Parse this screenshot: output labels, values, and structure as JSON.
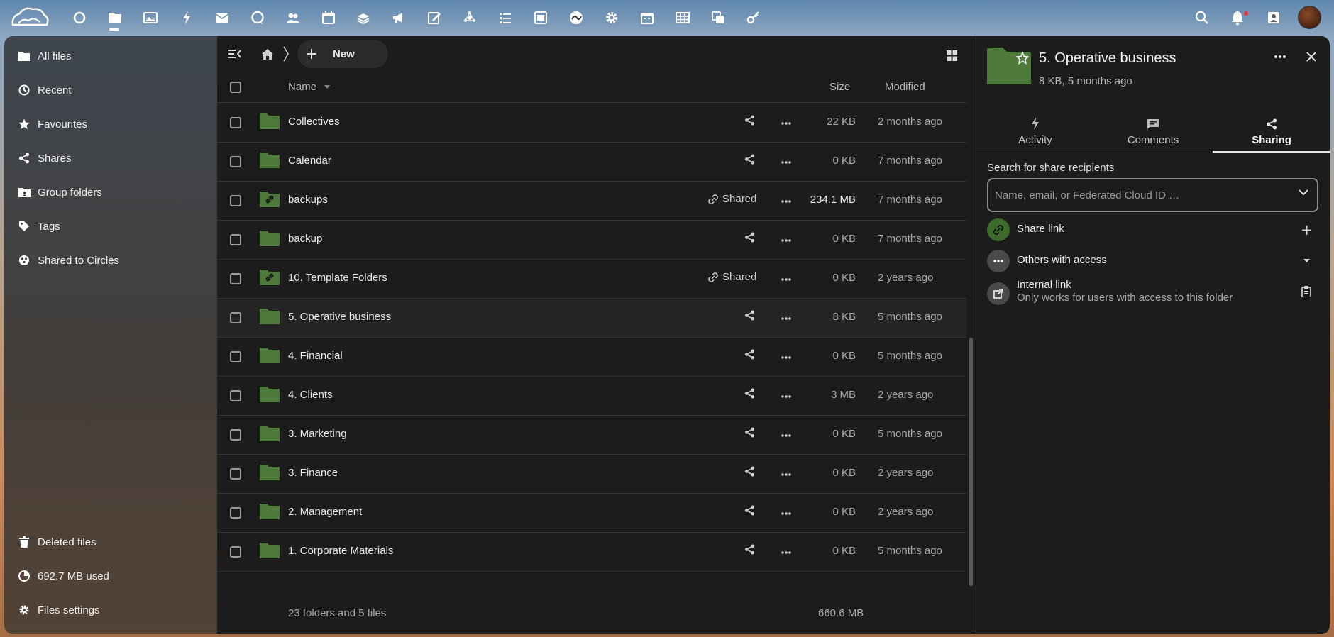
{
  "header": {
    "apps": [
      {
        "icon": "dashboard-icon"
      },
      {
        "icon": "files-icon"
      },
      {
        "icon": "photos-icon"
      },
      {
        "icon": "activity-icon"
      },
      {
        "icon": "mail-icon"
      },
      {
        "icon": "talk-icon"
      },
      {
        "icon": "contacts-icon"
      },
      {
        "icon": "calendar-icon"
      },
      {
        "icon": "deck-icon"
      },
      {
        "icon": "announcements-icon"
      },
      {
        "icon": "notes-icon"
      },
      {
        "icon": "circles-icon"
      },
      {
        "icon": "tasks-icon"
      },
      {
        "icon": "forms-icon"
      },
      {
        "icon": "whiteboard-icon"
      },
      {
        "icon": "settings-icon"
      },
      {
        "icon": "calendar-alt-icon"
      },
      {
        "icon": "tables-icon"
      },
      {
        "icon": "collectives-icon"
      },
      {
        "icon": "passwords-icon"
      }
    ],
    "right_icons": [
      "search-icon",
      "notifications-icon",
      "contacts-menu-icon"
    ]
  },
  "nav": {
    "items": [
      {
        "label": "All files",
        "icon": "folder-icon"
      },
      {
        "label": "Recent",
        "icon": "clock-icon"
      },
      {
        "label": "Favourites",
        "icon": "star-icon"
      },
      {
        "label": "Shares",
        "icon": "share-icon"
      },
      {
        "label": "Group folders",
        "icon": "group-folder-icon"
      },
      {
        "label": "Tags",
        "icon": "tag-icon"
      },
      {
        "label": "Shared to Circles",
        "icon": "circles-icon"
      }
    ],
    "bottom": [
      {
        "label": "Deleted files",
        "icon": "trash-icon"
      },
      {
        "label": "692.7 MB used",
        "icon": "quota-pie-icon"
      },
      {
        "label": "Files settings",
        "icon": "gear-icon"
      }
    ]
  },
  "files": {
    "new_label": "New",
    "columns": {
      "name": "Name",
      "size": "Size",
      "modified": "Modified"
    },
    "rows": [
      {
        "name": "Collectives",
        "size": "22 KB",
        "modified": "2 months ago",
        "shared": false
      },
      {
        "name": "Calendar",
        "size": "0 KB",
        "modified": "7 months ago",
        "shared": false
      },
      {
        "name": "backups",
        "size": "234.1 MB",
        "modified": "7 months ago",
        "shared": true,
        "share_label": "Shared"
      },
      {
        "name": "backup",
        "size": "0 KB",
        "modified": "7 months ago",
        "shared": false
      },
      {
        "name": "10. Template Folders",
        "size": "0 KB",
        "modified": "2 years ago",
        "shared": true,
        "share_label": "Shared"
      },
      {
        "name": "5. Operative business",
        "size": "8 KB",
        "modified": "5 months ago",
        "shared": false,
        "selected": true
      },
      {
        "name": "4. Financial",
        "size": "0 KB",
        "modified": "5 months ago",
        "shared": false
      },
      {
        "name": "4. Clients",
        "size": "3 MB",
        "modified": "2 years ago",
        "shared": false
      },
      {
        "name": "3. Marketing",
        "size": "0 KB",
        "modified": "5 months ago",
        "shared": false
      },
      {
        "name": "3. Finance",
        "size": "0 KB",
        "modified": "2 years ago",
        "shared": false
      },
      {
        "name": "2. Management",
        "size": "0 KB",
        "modified": "2 years ago",
        "shared": false
      },
      {
        "name": "1. Corporate Materials",
        "size": "0 KB",
        "modified": "5 months ago",
        "shared": false
      }
    ],
    "summary": "23 folders and 5 files",
    "total_size": "660.6 MB"
  },
  "sidebar": {
    "title": "5. Operative business",
    "subtitle": "8 KB, 5 months ago",
    "tabs": [
      {
        "label": "Activity",
        "icon": "activity-icon"
      },
      {
        "label": "Comments",
        "icon": "comment-icon"
      },
      {
        "label": "Sharing",
        "icon": "share-icon",
        "active": true
      }
    ],
    "search_label": "Search for share recipients",
    "search_placeholder": "Name, email, or Federated Cloud ID …",
    "share_link": "Share link",
    "others_access": "Others with access",
    "internal_link": "Internal link",
    "internal_link_desc": "Only works for users with access to this folder"
  },
  "colors": {
    "accent_folder": "#4d7a3a",
    "share_link_circle": "#3d6b2c",
    "bg_dark": "#1c1c1c"
  }
}
